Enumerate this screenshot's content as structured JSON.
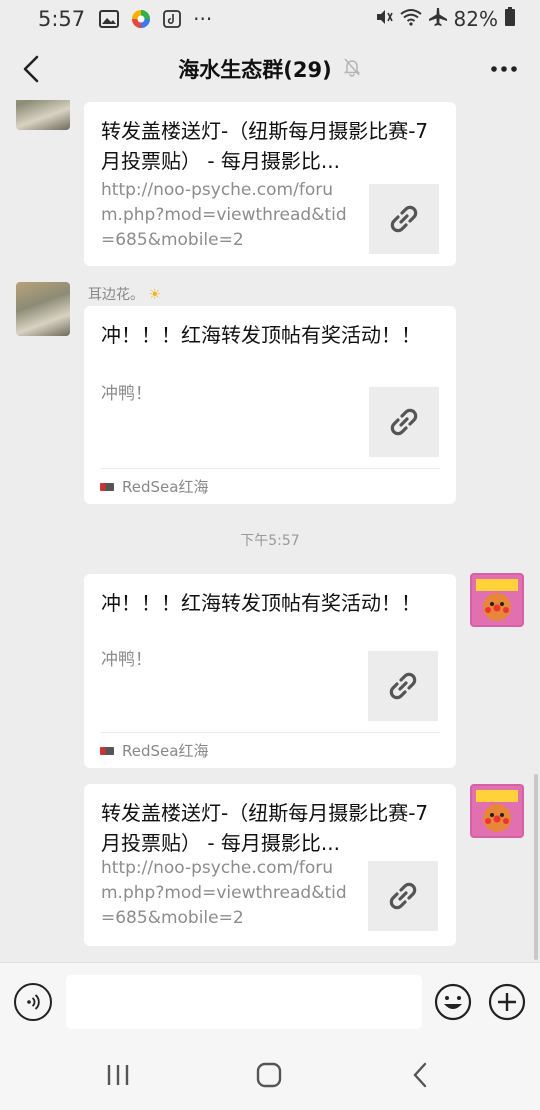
{
  "status_bar": {
    "time": "5:57",
    "dots": "···",
    "battery": "82%",
    "icons": [
      "gallery-icon",
      "color-wheel-icon",
      "tiktok-icon",
      "mute-icon",
      "wifi-icon",
      "airplane-icon",
      "battery-icon"
    ]
  },
  "header": {
    "title": "海水生态群(29)",
    "back_icon": "chevron-left-icon",
    "muted_icon": "bell-off-icon",
    "more_icon": "more-icon"
  },
  "messages": [
    {
      "sender": "",
      "title": "转发盖楼送灯-（纽斯每月摄影比赛-7月投票贴） - 每月摄影比...",
      "desc": "http://noo-psyche.com/forum.php?mod=viewthread&tid=685&mobile=2",
      "source": ""
    },
    {
      "sender": "耳边花。",
      "sender_emoji": "☀",
      "title": "冲！！！红海转发顶帖有奖活动！！",
      "desc": "冲鸭！",
      "source": "RedSea红海"
    },
    {
      "timestamp": "下午5:57"
    },
    {
      "title": "冲！！！红海转发顶帖有奖活动！！",
      "desc": "冲鸭！",
      "source": "RedSea红海"
    },
    {
      "title": "转发盖楼送灯-（纽斯每月摄影比赛-7月投票贴） - 每月摄影比...",
      "desc": "http://noo-psyche.com/forum.php?mod=viewthread&tid=685&mobile=2",
      "source": ""
    }
  ],
  "colors": {
    "background": "#ededed",
    "bubble": "#ffffff",
    "thumb_bg": "#ececec"
  }
}
